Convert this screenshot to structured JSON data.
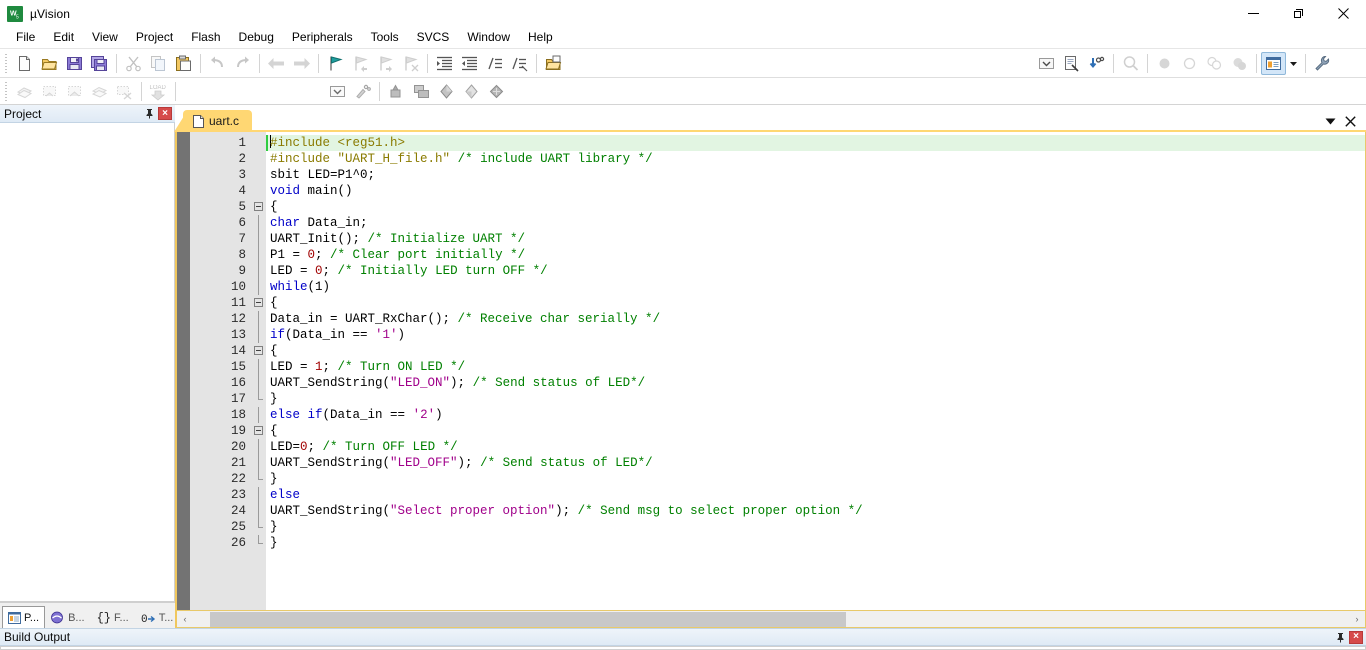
{
  "window": {
    "title": "µVision",
    "app_icon": "uvision-logo-icon",
    "minimize_label": "Minimize",
    "maximize_label": "Maximize",
    "close_label": "Close"
  },
  "menubar": {
    "items": [
      {
        "label": "File"
      },
      {
        "label": "Edit"
      },
      {
        "label": "View"
      },
      {
        "label": "Project"
      },
      {
        "label": "Flash"
      },
      {
        "label": "Debug"
      },
      {
        "label": "Peripherals"
      },
      {
        "label": "Tools"
      },
      {
        "label": "SVCS"
      },
      {
        "label": "Window"
      },
      {
        "label": "Help"
      }
    ]
  },
  "toolbar_file": {
    "groups": [
      [
        {
          "icon": "new-file-icon",
          "label": "New",
          "enabled": true
        },
        {
          "icon": "open-folder-icon",
          "label": "Open",
          "enabled": true
        },
        {
          "icon": "save-icon",
          "label": "Save",
          "enabled": true
        },
        {
          "icon": "save-all-icon",
          "label": "Save All",
          "enabled": true
        }
      ],
      [
        {
          "icon": "cut-scissors-icon",
          "label": "Cut",
          "enabled": false
        },
        {
          "icon": "copy-icon",
          "label": "Copy",
          "enabled": false
        },
        {
          "icon": "paste-clipboard-icon",
          "label": "Paste",
          "enabled": true
        }
      ],
      [
        {
          "icon": "undo-arrow-icon",
          "label": "Undo",
          "enabled": false
        },
        {
          "icon": "redo-arrow-icon",
          "label": "Redo",
          "enabled": false
        }
      ],
      [
        {
          "icon": "navigate-back-icon",
          "label": "Back",
          "enabled": false
        },
        {
          "icon": "navigate-forward-icon",
          "label": "Forward",
          "enabled": false
        }
      ],
      [
        {
          "icon": "bookmark-toggle-icon",
          "label": "Insert/Remove Bookmark",
          "enabled": true
        },
        {
          "icon": "bookmark-prev-icon",
          "label": "Previous Bookmark",
          "enabled": false
        },
        {
          "icon": "bookmark-next-icon",
          "label": "Next Bookmark",
          "enabled": false
        },
        {
          "icon": "bookmark-clear-icon",
          "label": "Clear All Bookmarks",
          "enabled": false
        }
      ],
      [
        {
          "icon": "indent-right-icon",
          "label": "Indent Selected Text",
          "enabled": true
        },
        {
          "icon": "indent-left-icon",
          "label": "Unindent Selected Text",
          "enabled": true
        },
        {
          "icon": "comment-lines-icon",
          "label": "Comment Selection",
          "enabled": true
        },
        {
          "icon": "uncomment-lines-icon",
          "label": "Uncomment Selection",
          "enabled": true
        }
      ],
      [
        {
          "icon": "open-project-icon",
          "label": "Open Project",
          "enabled": true
        }
      ]
    ]
  },
  "toolbar_build": {
    "groups": [
      [
        {
          "icon": "translate-file-icon",
          "label": "Translate",
          "enabled": false
        },
        {
          "icon": "build-target-icon",
          "label": "Build",
          "enabled": false
        },
        {
          "icon": "rebuild-all-icon",
          "label": "Rebuild",
          "enabled": false
        },
        {
          "icon": "batch-build-icon",
          "label": "Batch Build",
          "enabled": false
        },
        {
          "icon": "stop-build-icon",
          "label": "Stop Build",
          "enabled": false
        }
      ],
      [
        {
          "icon": "download-load-icon",
          "label": "Download",
          "enabled": false
        }
      ]
    ],
    "right_groups": [
      [
        {
          "icon": "target-select-dropdown-icon",
          "label": "Select Target",
          "enabled": true
        },
        {
          "icon": "target-options-icon",
          "label": "Options for Target",
          "enabled": true
        }
      ],
      [
        {
          "icon": "manage-project-items-icon",
          "label": "Manage Project Items",
          "enabled": true
        },
        {
          "icon": "multi-project-icon",
          "label": "Manage Multi-Project",
          "enabled": true
        },
        {
          "icon": "component-blue-icon",
          "label": "Manage Run-Time Environment",
          "enabled": true
        },
        {
          "icon": "component-yellow-icon",
          "label": "Select Software Packs",
          "enabled": true
        },
        {
          "icon": "pack-installer-icon",
          "label": "Pack Installer",
          "enabled": true
        }
      ]
    ]
  },
  "toolbar_debug_right": {
    "items": [
      {
        "icon": "chevron-down-box-icon",
        "label": "Insert/Remove Breakpoint Menu",
        "enabled": true
      },
      {
        "icon": "source-browse-icon",
        "label": "Source Browse",
        "enabled": true
      },
      {
        "icon": "find-in-files-icon",
        "label": "Find in Files",
        "enabled": true
      },
      {
        "icon": "zoom-search-icon",
        "label": "Text Search",
        "enabled": false
      },
      {
        "icon": "breakpoint-filled-icon",
        "label": "Insert/Remove Breakpoint",
        "enabled": false
      },
      {
        "icon": "breakpoint-empty-icon",
        "label": "Enable/Disable Breakpoint",
        "enabled": false
      },
      {
        "icon": "breakpoints-disable-all-icon",
        "label": "Disable All Breakpoints",
        "enabled": false
      },
      {
        "icon": "breakpoints-kill-all-icon",
        "label": "Kill All Breakpoints",
        "enabled": false
      },
      {
        "icon": "window-layout-icon",
        "label": "Window Layout",
        "enabled": true,
        "active": true
      },
      {
        "icon": "layout-dropdown-arrow-icon",
        "label": "Window Layout Options",
        "enabled": true
      },
      {
        "icon": "wrench-configure-icon",
        "label": "Configuration",
        "enabled": true
      }
    ]
  },
  "project_panel": {
    "title": "Project",
    "pin_icon": "pin-icon",
    "close_icon": "close-icon",
    "tabs": [
      {
        "icon": "project-window-icon",
        "label": "P...",
        "selected": true
      },
      {
        "icon": "books-icon",
        "label": "B...",
        "selected": false
      },
      {
        "icon": "braces-functions-icon",
        "label": "F...",
        "selected": false
      },
      {
        "icon": "templates-icon",
        "label": "T...",
        "selected": false
      }
    ]
  },
  "editor": {
    "tab": {
      "label": "uart.c",
      "icon": "c-file-icon",
      "active": true
    },
    "tabstrip_buttons": [
      {
        "icon": "chevron-down-icon",
        "label": "Active Files List"
      },
      {
        "icon": "close-icon",
        "label": "Close Document"
      }
    ],
    "first_line": 1,
    "last_line": 26,
    "lines": [
      {
        "n": 1,
        "fold": "none",
        "hl": true,
        "caret": true,
        "tokens": [
          {
            "t": "#include ",
            "c": "pre"
          },
          {
            "t": "<reg51.h>",
            "c": "pre"
          }
        ]
      },
      {
        "n": 2,
        "fold": "none",
        "tokens": [
          {
            "t": "#include ",
            "c": "pre"
          },
          {
            "t": "\"UART_H_file.h\"",
            "c": "pre"
          },
          {
            "t": " ",
            "c": "txt"
          },
          {
            "t": "/* include UART library */",
            "c": "cmt"
          }
        ]
      },
      {
        "n": 3,
        "fold": "none",
        "tokens": [
          {
            "t": "sbit LED=P1^0;",
            "c": "txt"
          }
        ]
      },
      {
        "n": 4,
        "fold": "none",
        "tokens": [
          {
            "t": "void",
            "c": "kw"
          },
          {
            "t": " main()",
            "c": "txt"
          }
        ]
      },
      {
        "n": 5,
        "fold": "box",
        "tokens": [
          {
            "t": "{",
            "c": "txt"
          }
        ]
      },
      {
        "n": 6,
        "fold": "line",
        "tokens": [
          {
            "t": "char",
            "c": "kw"
          },
          {
            "t": " Data_in;",
            "c": "txt"
          }
        ]
      },
      {
        "n": 7,
        "fold": "line",
        "tokens": [
          {
            "t": "UART_Init(); ",
            "c": "txt"
          },
          {
            "t": "/* Initialize UART */",
            "c": "cmt"
          }
        ]
      },
      {
        "n": 8,
        "fold": "line",
        "tokens": [
          {
            "t": "P1 = ",
            "c": "txt"
          },
          {
            "t": "0",
            "c": "num"
          },
          {
            "t": "; ",
            "c": "txt"
          },
          {
            "t": "/* Clear port initially */",
            "c": "cmt"
          }
        ]
      },
      {
        "n": 9,
        "fold": "line",
        "tokens": [
          {
            "t": "LED = ",
            "c": "txt"
          },
          {
            "t": "0",
            "c": "num"
          },
          {
            "t": "; ",
            "c": "txt"
          },
          {
            "t": "/* Initially LED turn OFF */",
            "c": "cmt"
          }
        ]
      },
      {
        "n": 10,
        "fold": "line",
        "tokens": [
          {
            "t": "while",
            "c": "kw"
          },
          {
            "t": "(1)",
            "c": "txt"
          }
        ]
      },
      {
        "n": 11,
        "fold": "box",
        "tokens": [
          {
            "t": "{",
            "c": "txt"
          }
        ]
      },
      {
        "n": 12,
        "fold": "line",
        "tokens": [
          {
            "t": "Data_in = UART_RxChar(); ",
            "c": "txt"
          },
          {
            "t": "/* Receive char serially */",
            "c": "cmt"
          }
        ]
      },
      {
        "n": 13,
        "fold": "line",
        "tokens": [
          {
            "t": "if",
            "c": "kw"
          },
          {
            "t": "(Data_in == ",
            "c": "txt"
          },
          {
            "t": "'1'",
            "c": "chr"
          },
          {
            "t": ")",
            "c": "txt"
          }
        ]
      },
      {
        "n": 14,
        "fold": "box",
        "tokens": [
          {
            "t": "{",
            "c": "txt"
          }
        ]
      },
      {
        "n": 15,
        "fold": "line",
        "tokens": [
          {
            "t": "LED = ",
            "c": "txt"
          },
          {
            "t": "1",
            "c": "num"
          },
          {
            "t": "; ",
            "c": "txt"
          },
          {
            "t": "/* Turn ON LED */",
            "c": "cmt"
          }
        ]
      },
      {
        "n": 16,
        "fold": "line",
        "tokens": [
          {
            "t": "UART_SendString(",
            "c": "txt"
          },
          {
            "t": "\"LED_ON\"",
            "c": "str"
          },
          {
            "t": "); ",
            "c": "txt"
          },
          {
            "t": "/* Send status of LED*/",
            "c": "cmt"
          }
        ]
      },
      {
        "n": 17,
        "fold": "end",
        "tokens": [
          {
            "t": "}",
            "c": "txt"
          }
        ]
      },
      {
        "n": 18,
        "fold": "line",
        "tokens": [
          {
            "t": "else",
            "c": "kw"
          },
          {
            "t": " ",
            "c": "txt"
          },
          {
            "t": "if",
            "c": "kw"
          },
          {
            "t": "(Data_in == ",
            "c": "txt"
          },
          {
            "t": "'2'",
            "c": "chr"
          },
          {
            "t": ")",
            "c": "txt"
          }
        ]
      },
      {
        "n": 19,
        "fold": "box",
        "tokens": [
          {
            "t": "{",
            "c": "txt"
          }
        ]
      },
      {
        "n": 20,
        "fold": "line",
        "tokens": [
          {
            "t": "LED=",
            "c": "txt"
          },
          {
            "t": "0",
            "c": "num"
          },
          {
            "t": "; ",
            "c": "txt"
          },
          {
            "t": "/* Turn OFF LED */",
            "c": "cmt"
          }
        ]
      },
      {
        "n": 21,
        "fold": "line",
        "tokens": [
          {
            "t": "UART_SendString(",
            "c": "txt"
          },
          {
            "t": "\"LED_OFF\"",
            "c": "str"
          },
          {
            "t": "); ",
            "c": "txt"
          },
          {
            "t": "/* Send status of LED*/",
            "c": "cmt"
          }
        ]
      },
      {
        "n": 22,
        "fold": "end",
        "tokens": [
          {
            "t": "}",
            "c": "txt"
          }
        ]
      },
      {
        "n": 23,
        "fold": "line",
        "tokens": [
          {
            "t": "else",
            "c": "kw"
          }
        ]
      },
      {
        "n": 24,
        "fold": "line",
        "tokens": [
          {
            "t": "UART_SendString(",
            "c": "txt"
          },
          {
            "t": "\"Select proper option\"",
            "c": "str"
          },
          {
            "t": "); ",
            "c": "txt"
          },
          {
            "t": "/* Send msg to select proper option */",
            "c": "cmt"
          }
        ]
      },
      {
        "n": 25,
        "fold": "end",
        "tokens": [
          {
            "t": "}",
            "c": "txt"
          }
        ]
      },
      {
        "n": 26,
        "fold": "end",
        "tokens": [
          {
            "t": "}",
            "c": "txt"
          }
        ]
      }
    ],
    "hscroll": {
      "left_arrow": "‹",
      "right_arrow": "›",
      "thumb_start_pct": 1.5,
      "thumb_width_pct": 55
    }
  },
  "build_output": {
    "title": "Build Output",
    "pin_icon": "pin-icon",
    "close_icon": "close-icon",
    "text": ""
  },
  "colors": {
    "tab_active": "#ffd773",
    "gutter": "#e4e4e4",
    "selection_margin": "#737373",
    "line_highlight": "#e2f5e2",
    "change_bar": "#2ecc40",
    "panel_header": "#dfeaf5",
    "keyword": "#0000c8",
    "preprocessor": "#8a7b00",
    "string": "#a0008a",
    "comment": "#008000",
    "number": "#a00000",
    "close_button": "#d64b4b",
    "toolbar_active": "#d3e6f8"
  }
}
